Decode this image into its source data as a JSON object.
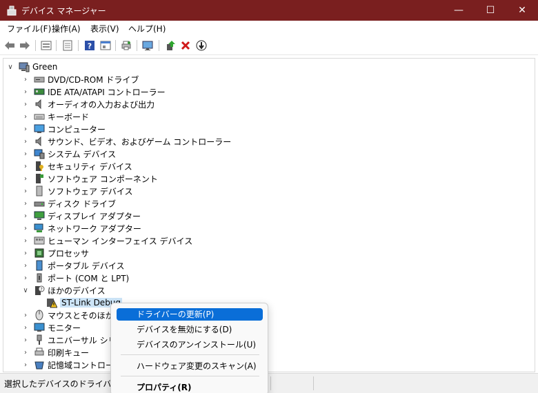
{
  "window": {
    "title": "デバイス マネージャー",
    "controls": {
      "minimize": "—",
      "maximize": "☐",
      "close": "✕"
    }
  },
  "menu": [
    "ファイル(F)",
    "操作(A)",
    "表示(V)",
    "ヘルプ(H)"
  ],
  "toolbar_icons": [
    "back-icon",
    "forward-icon",
    "properties-view-icon",
    "list-view-icon",
    "help-icon",
    "action-view-icon",
    "print-icon",
    "monitor-scan-icon",
    "update-driver-icon",
    "uninstall-icon",
    "disable-device-icon"
  ],
  "tree": {
    "root": {
      "label": "Green"
    },
    "items": [
      {
        "label": "DVD/CD-ROM ドライブ",
        "icon": "dvd-drive-icon"
      },
      {
        "label": "IDE ATA/ATAPI コントローラー",
        "icon": "ide-controller-icon"
      },
      {
        "label": "オーディオの入力および出力",
        "icon": "audio-icon"
      },
      {
        "label": "キーボード",
        "icon": "keyboard-icon"
      },
      {
        "label": "コンピューター",
        "icon": "computer-icon"
      },
      {
        "label": "サウンド、ビデオ、およびゲーム コントローラー",
        "icon": "sound-icon"
      },
      {
        "label": "システム デバイス",
        "icon": "system-device-icon"
      },
      {
        "label": "セキュリティ デバイス",
        "icon": "security-device-icon"
      },
      {
        "label": "ソフトウェア コンポーネント",
        "icon": "software-component-icon"
      },
      {
        "label": "ソフトウェア デバイス",
        "icon": "software-device-icon"
      },
      {
        "label": "ディスク ドライブ",
        "icon": "disk-drive-icon"
      },
      {
        "label": "ディスプレイ アダプター",
        "icon": "display-adapter-icon"
      },
      {
        "label": "ネットワーク アダプター",
        "icon": "network-adapter-icon"
      },
      {
        "label": "ヒューマン インターフェイス デバイス",
        "icon": "hid-icon"
      },
      {
        "label": "プロセッサ",
        "icon": "processor-icon"
      },
      {
        "label": "ポータブル デバイス",
        "icon": "portable-device-icon"
      },
      {
        "label": "ポート (COM と LPT)",
        "icon": "port-icon"
      },
      {
        "label": "ほかのデバイス",
        "icon": "unknown-device-icon"
      },
      {
        "label": "ST-Link Debug",
        "icon": "warning-device-icon"
      },
      {
        "label": "マウスとそのほかのポ",
        "icon": "mouse-icon"
      },
      {
        "label": "モニター",
        "icon": "monitor-icon"
      },
      {
        "label": "ユニバーサル シリアル",
        "icon": "usb-icon"
      },
      {
        "label": "印刷キュー",
        "icon": "print-queue-icon"
      },
      {
        "label": "記憶域コントローラー",
        "icon": "storage-controller-icon"
      }
    ]
  },
  "context_menu": {
    "items": [
      "ドライバーの更新(P)",
      "デバイスを無効にする(D)",
      "デバイスのアンインストール(U)",
      "ハードウェア変更のスキャン(A)",
      "プロパティ(R)"
    ]
  },
  "status": {
    "text": "選択したデバイスのドライバー更新"
  },
  "colors": {
    "titlebar": "#7a1f1f",
    "highlight": "#0a6ed8",
    "selection": "#cce4f7"
  }
}
